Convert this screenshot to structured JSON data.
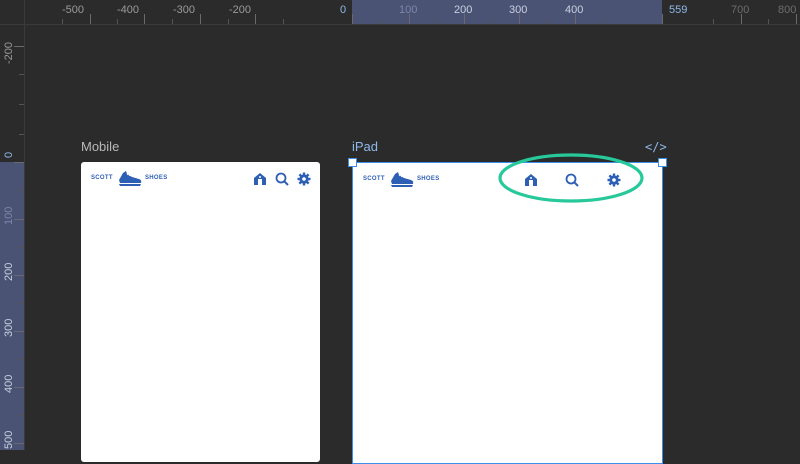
{
  "ruler": {
    "top_labels": [
      "-500",
      "-400",
      "-300",
      "-200",
      "0",
      "100",
      "200",
      "300",
      "400",
      "559",
      "700",
      "800"
    ],
    "left_labels": [
      "-200",
      "0",
      "100",
      "200",
      "300",
      "400",
      "500"
    ]
  },
  "frames": {
    "mobile": {
      "title": "Mobile"
    },
    "ipad": {
      "title": "iPad",
      "code_icon": "</>"
    }
  },
  "brand": {
    "word1": "SCOTT",
    "word2": "SHOES",
    "logo_icon": "shoe-icon"
  },
  "nav_icons": [
    "home-icon",
    "search-icon",
    "gear-icon"
  ],
  "colors": {
    "canvas": "#2b2b2b",
    "ruler_highlight": "#4a5374",
    "selection": "#3d8ee8",
    "brand": "#2d5fb4",
    "annotation": "#27c99b"
  }
}
